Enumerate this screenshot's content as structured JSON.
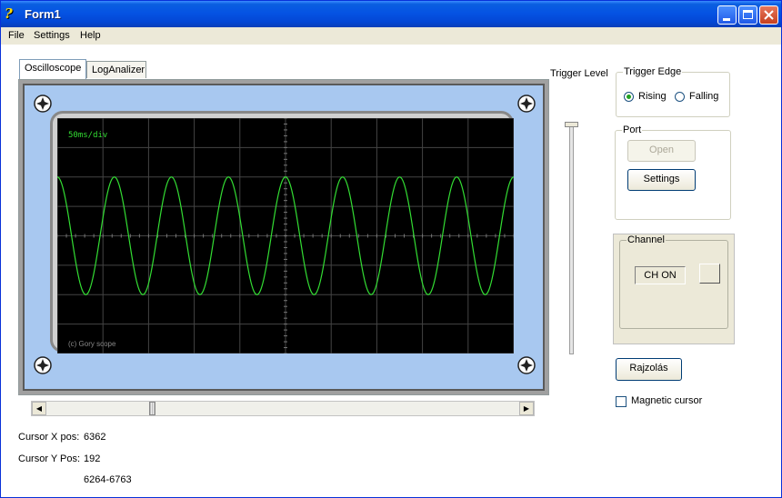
{
  "window": {
    "title": "Form1",
    "icon": "app-icon"
  },
  "menu": [
    "File",
    "Settings",
    "Help"
  ],
  "tabs": [
    {
      "label": "Oscilloscope",
      "active": true
    },
    {
      "label": "LogAnalizer",
      "active": false
    }
  ],
  "scope": {
    "timebase": "50ms/div",
    "copyright": "(c) Gory scope",
    "trace_color": "#33dd33",
    "grid_color": "#444444",
    "cycles_visible": 8
  },
  "scrollbar": {
    "position_fraction": 0.22
  },
  "trigger_level": {
    "label": "Trigger Level",
    "value_fraction": 0.0
  },
  "trigger_edge": {
    "title": "Trigger Edge",
    "rising": "Rising",
    "falling": "Falling",
    "selected": "Rising"
  },
  "port": {
    "title": "Port",
    "open_label": "Open",
    "settings_label": "Settings"
  },
  "channel": {
    "title": "Channel",
    "status": "CH ON"
  },
  "draw_button": "Rajzolás",
  "magnetic_cursor": {
    "label": "Magnetic cursor",
    "checked": false
  },
  "cursor": {
    "x_label": "Cursor X pos:",
    "x_value": "6362",
    "y_label": "Cursor Y Pos:",
    "y_value": "192",
    "range": "6264-6763"
  }
}
